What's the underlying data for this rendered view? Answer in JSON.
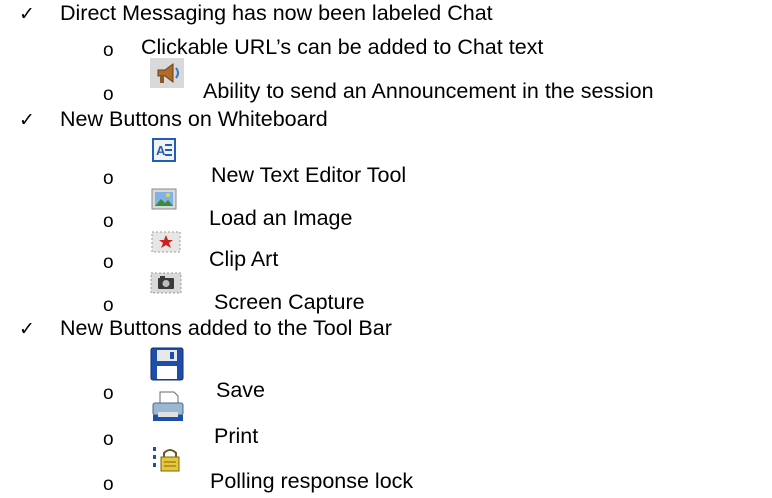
{
  "sections": [
    {
      "heading": "Direct Messaging has now been labeled Chat",
      "items": [
        {
          "text": "Clickable URL’s can be added to Chat text",
          "icon": ""
        },
        {
          "text": "Ability to send an Announcement in the session",
          "icon": "megaphone-icon"
        }
      ]
    },
    {
      "heading": "New Buttons on Whiteboard",
      "items": [
        {
          "text": "New Text Editor Tool",
          "icon": "text-editor-icon"
        },
        {
          "text": "Load an Image",
          "icon": "image-icon"
        },
        {
          "text": "Clip Art",
          "icon": "clip-art-icon"
        },
        {
          "text": "Screen Capture",
          "icon": "camera-icon"
        }
      ]
    },
    {
      "heading": "New Buttons added to the Tool Bar",
      "items": [
        {
          "text": "Save",
          "icon": "floppy-disk-icon"
        },
        {
          "text": "Print",
          "icon": "printer-icon"
        },
        {
          "text": "Polling response lock",
          "icon": "polling-lock-icon"
        }
      ]
    }
  ],
  "glyphs": {
    "check": "✓",
    "bullet": "o"
  },
  "colors": {
    "text": "#000000",
    "icon_blue": "#1f5fb4",
    "icon_gray": "#c8c8c8"
  }
}
